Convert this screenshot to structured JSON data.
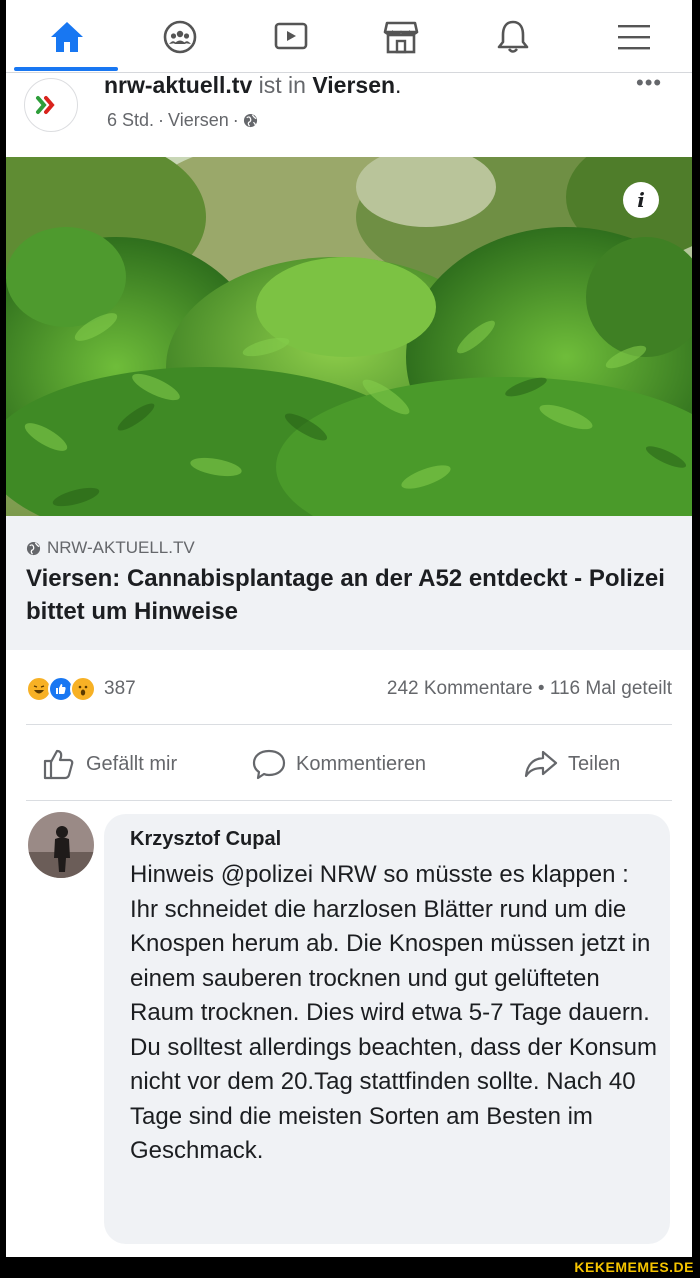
{
  "nav": {
    "items": [
      {
        "icon": "home-icon",
        "active": true
      },
      {
        "icon": "groups-icon",
        "active": false
      },
      {
        "icon": "watch-video-icon",
        "active": false
      },
      {
        "icon": "marketplace-icon",
        "active": false
      },
      {
        "icon": "bell-icon",
        "active": false
      },
      {
        "icon": "menu-icon",
        "active": false
      }
    ],
    "accent": "#1877f2"
  },
  "post": {
    "page_name": "nrw-aktuell.tv",
    "is_in": "ist in",
    "place": "Viersen",
    "period": ".",
    "meta_time": "6 Std.",
    "meta_sep": "·",
    "meta_place": "Viersen",
    "meta_sep2": "·",
    "more": "•••"
  },
  "image": {
    "info_icon": "i",
    "icon_name": "info-icon"
  },
  "link": {
    "source": "NRW-AKTUELL.TV",
    "title": "Viersen: Cannabisplantage an der A52 entdeckt - Polizei bittet um Hinweise"
  },
  "engagement": {
    "reaction_count": "387",
    "stats": "242 Kommentare • 116 Mal geteilt",
    "reactions": [
      "haha",
      "like",
      "wow"
    ]
  },
  "actions": {
    "like": "Gefällt mir",
    "comment": "Kommentieren",
    "share": "Teilen"
  },
  "comment": {
    "author": "Krzysztof Cupal",
    "text": "Hinweis @polizei NRW so müsste es klappen : Ihr schneidet die harzlosen Blätter rund um die Knospen herum ab. Die Knospen müssen jetzt in einem sauberen trocknen und gut gelüfteten Raum trocknen. Dies wird etwa 5-7 Tage dauern. Du solltest allerdings beachten, dass der Konsum nicht vor dem 20.Tag stattfinden sollte. Nach 40 Tage sind die meisten Sorten am Besten im Geschmack."
  },
  "watermark": "KEKEMEMES.DE"
}
